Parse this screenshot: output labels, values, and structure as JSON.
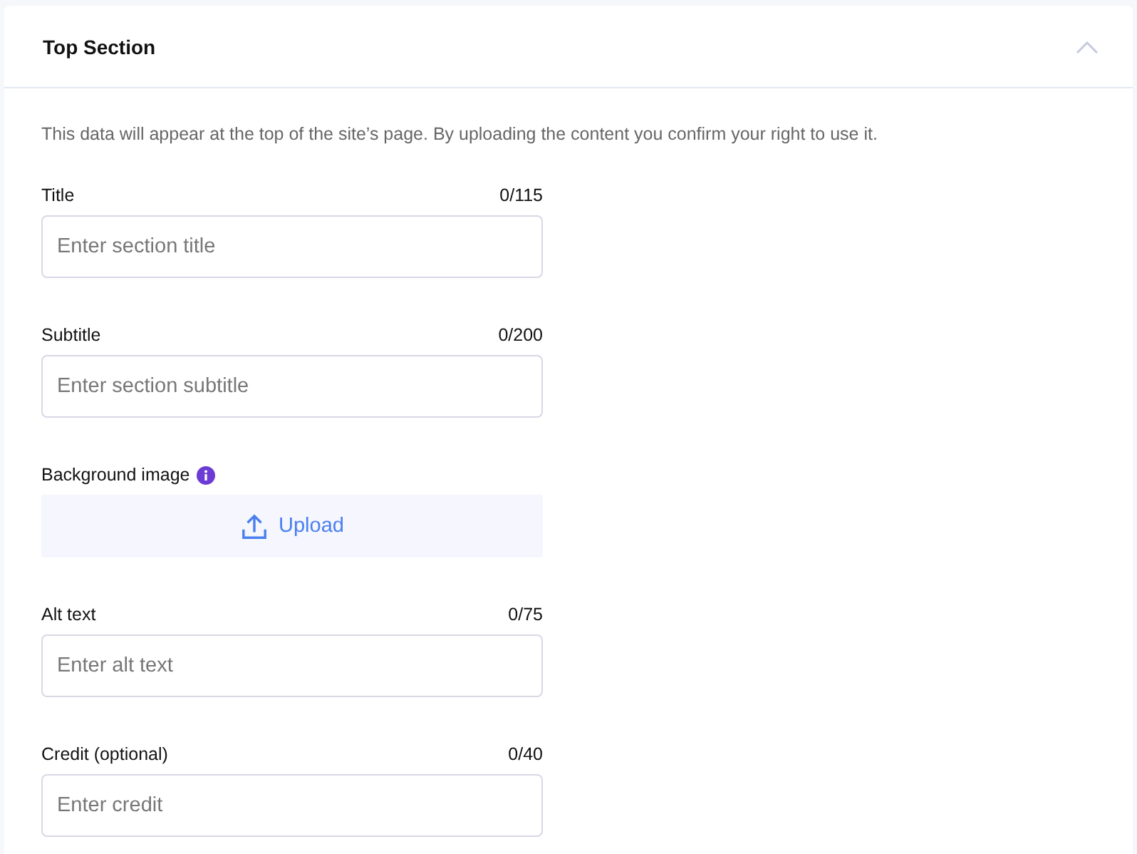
{
  "section": {
    "title": "Top Section",
    "expanded": true,
    "description": "This data will appear at the top of the site’s page. By uploading the content you confirm your right to use it.",
    "fields": [
      {
        "kind": "text",
        "label": "Title",
        "counter": "0/115",
        "placeholder": "Enter section title"
      },
      {
        "kind": "text",
        "label": "Subtitle",
        "counter": "0/200",
        "placeholder": "Enter section subtitle"
      },
      {
        "kind": "upload",
        "label": "Background image",
        "info": true,
        "button": "Upload"
      },
      {
        "kind": "text",
        "label": "Alt text",
        "counter": "0/75",
        "placeholder": "Enter alt text"
      },
      {
        "kind": "text",
        "label": "Credit (optional)",
        "counter": "0/40",
        "placeholder": "Enter credit"
      }
    ]
  }
}
